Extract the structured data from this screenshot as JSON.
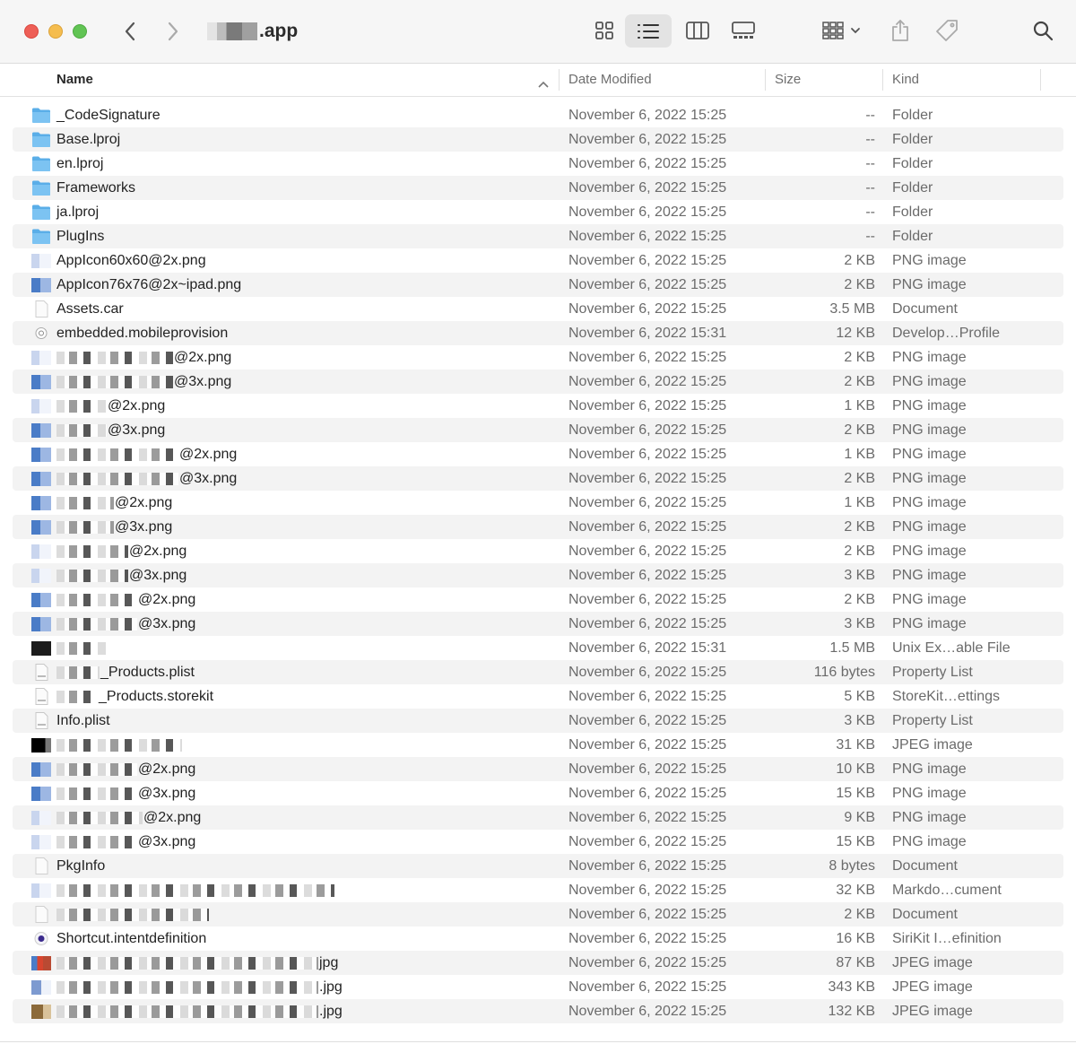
{
  "window": {
    "title": ".app"
  },
  "toolbar": {
    "back_icon": "chevron-left-icon",
    "forward_icon": "chevron-right-icon",
    "views": [
      "icon-view-icon",
      "list-view-icon",
      "column-view-icon",
      "gallery-view-icon"
    ],
    "group_icon": "group-by-icon",
    "share_icon": "share-icon",
    "tag_icon": "tag-icon",
    "search_icon": "search-icon"
  },
  "columns": {
    "name": "Name",
    "date": "Date Modified",
    "size": "Size",
    "kind": "Kind"
  },
  "rows": [
    {
      "name": "_CodeSignature",
      "date": "November 6, 2022 15:25",
      "size": "--",
      "kind": "Folder",
      "icon": "folder-icon"
    },
    {
      "name": "Base.lproj",
      "date": "November 6, 2022 15:25",
      "size": "--",
      "kind": "Folder",
      "icon": "folder-icon"
    },
    {
      "name": "en.lproj",
      "date": "November 6, 2022 15:25",
      "size": "--",
      "kind": "Folder",
      "icon": "folder-icon"
    },
    {
      "name": "Frameworks",
      "date": "November 6, 2022 15:25",
      "size": "--",
      "kind": "Folder",
      "icon": "folder-icon"
    },
    {
      "name": "ja.lproj",
      "date": "November 6, 2022 15:25",
      "size": "--",
      "kind": "Folder",
      "icon": "folder-icon"
    },
    {
      "name": "PlugIns",
      "date": "November 6, 2022 15:25",
      "size": "--",
      "kind": "Folder",
      "icon": "folder-icon"
    },
    {
      "name": "AppIcon60x60@2x.png",
      "date": "November 6, 2022 15:25",
      "size": "2 KB",
      "kind": "PNG image",
      "icon": "image-icon"
    },
    {
      "name": "AppIcon76x76@2x~ipad.png",
      "date": "November 6, 2022 15:25",
      "size": "2 KB",
      "kind": "PNG image",
      "icon": "image-icon"
    },
    {
      "name": "Assets.car",
      "date": "November 6, 2022 15:25",
      "size": "3.5 MB",
      "kind": "Document",
      "icon": "document-icon"
    },
    {
      "name": "embedded.mobileprovision",
      "date": "November 6, 2022 15:31",
      "size": "12 KB",
      "kind": "Develop…Profile",
      "icon": "provision-icon"
    },
    {
      "name": "@2x.png",
      "date": "November 6, 2022 15:25",
      "size": "2 KB",
      "kind": "PNG image",
      "icon": "image-icon"
    },
    {
      "name": "@3x.png",
      "date": "November 6, 2022 15:25",
      "size": "2 KB",
      "kind": "PNG image",
      "icon": "image-icon"
    },
    {
      "name": "@2x.png",
      "date": "November 6, 2022 15:25",
      "size": "1 KB",
      "kind": "PNG image",
      "icon": "image-icon"
    },
    {
      "name": "@3x.png",
      "date": "November 6, 2022 15:25",
      "size": "2 KB",
      "kind": "PNG image",
      "icon": "image-icon"
    },
    {
      "name": "@2x.png",
      "date": "November 6, 2022 15:25",
      "size": "1 KB",
      "kind": "PNG image",
      "icon": "image-icon"
    },
    {
      "name": "@3x.png",
      "date": "November 6, 2022 15:25",
      "size": "2 KB",
      "kind": "PNG image",
      "icon": "image-icon"
    },
    {
      "name": "@2x.png",
      "date": "November 6, 2022 15:25",
      "size": "1 KB",
      "kind": "PNG image",
      "icon": "image-icon"
    },
    {
      "name": "@3x.png",
      "date": "November 6, 2022 15:25",
      "size": "2 KB",
      "kind": "PNG image",
      "icon": "image-icon"
    },
    {
      "name": "@2x.png",
      "date": "November 6, 2022 15:25",
      "size": "2 KB",
      "kind": "PNG image",
      "icon": "image-icon"
    },
    {
      "name": "@3x.png",
      "date": "November 6, 2022 15:25",
      "size": "3 KB",
      "kind": "PNG image",
      "icon": "image-icon"
    },
    {
      "name": "@2x.png",
      "date": "November 6, 2022 15:25",
      "size": "2 KB",
      "kind": "PNG image",
      "icon": "image-icon"
    },
    {
      "name": "@3x.png",
      "date": "November 6, 2022 15:25",
      "size": "3 KB",
      "kind": "PNG image",
      "icon": "image-icon"
    },
    {
      "name": "",
      "date": "November 6, 2022 15:31",
      "size": "1.5 MB",
      "kind": "Unix Ex…able File",
      "icon": "executable-icon"
    },
    {
      "name": "_Products.plist",
      "date": "November 6, 2022 15:25",
      "size": "116 bytes",
      "kind": "Property List",
      "icon": "plist-icon"
    },
    {
      "name": "_Products.storekit",
      "date": "November 6, 2022 15:25",
      "size": "5 KB",
      "kind": "StoreKit…ettings",
      "icon": "storekit-icon"
    },
    {
      "name": "Info.plist",
      "date": "November 6, 2022 15:25",
      "size": "3 KB",
      "kind": "Property List",
      "icon": "plist-icon"
    },
    {
      "name": "",
      "date": "November 6, 2022 15:25",
      "size": "31 KB",
      "kind": "JPEG image",
      "icon": "image-icon"
    },
    {
      "name": "@2x.png",
      "date": "November 6, 2022 15:25",
      "size": "10 KB",
      "kind": "PNG image",
      "icon": "image-icon"
    },
    {
      "name": "@3x.png",
      "date": "November 6, 2022 15:25",
      "size": "15 KB",
      "kind": "PNG image",
      "icon": "image-icon"
    },
    {
      "name": "@2x.png",
      "date": "November 6, 2022 15:25",
      "size": "9 KB",
      "kind": "PNG image",
      "icon": "image-icon"
    },
    {
      "name": "@3x.png",
      "date": "November 6, 2022 15:25",
      "size": "15 KB",
      "kind": "PNG image",
      "icon": "image-icon"
    },
    {
      "name": "PkgInfo",
      "date": "November 6, 2022 15:25",
      "size": "8 bytes",
      "kind": "Document",
      "icon": "document-icon"
    },
    {
      "name": "",
      "date": "November 6, 2022 15:25",
      "size": "32 KB",
      "kind": "Markdo…cument",
      "icon": "image-icon"
    },
    {
      "name": "",
      "date": "November 6, 2022 15:25",
      "size": "2 KB",
      "kind": "Document",
      "icon": "document-icon"
    },
    {
      "name": "Shortcut.intentdefinition",
      "date": "November 6, 2022 15:25",
      "size": "16 KB",
      "kind": "SiriKit I…efinition",
      "icon": "intent-icon"
    },
    {
      "name": "jpg",
      "date": "November 6, 2022 15:25",
      "size": "87 KB",
      "kind": "JPEG image",
      "icon": "image-icon"
    },
    {
      "name": ".jpg",
      "date": "November 6, 2022 15:25",
      "size": "343 KB",
      "kind": "JPEG image",
      "icon": "image-icon"
    },
    {
      "name": ".jpg",
      "date": "November 6, 2022 15:25",
      "size": "132 KB",
      "kind": "JPEG image",
      "icon": "image-icon"
    }
  ]
}
